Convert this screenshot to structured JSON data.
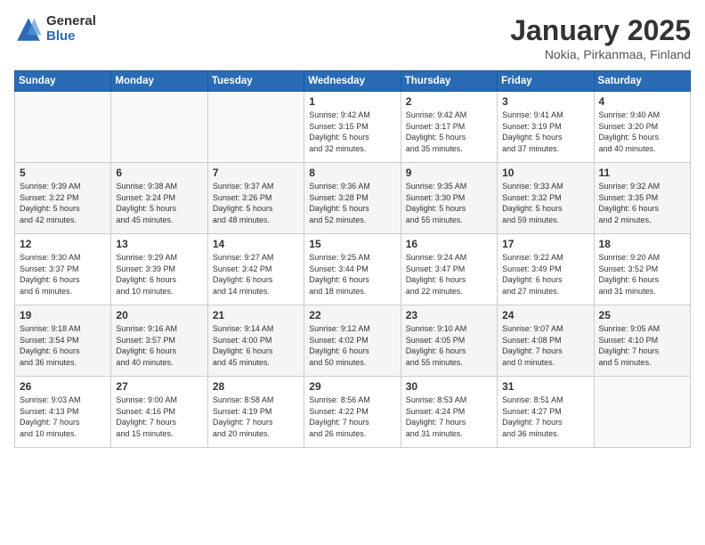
{
  "logo": {
    "general": "General",
    "blue": "Blue"
  },
  "title": "January 2025",
  "subtitle": "Nokia, Pirkanmaa, Finland",
  "weekdays": [
    "Sunday",
    "Monday",
    "Tuesday",
    "Wednesday",
    "Thursday",
    "Friday",
    "Saturday"
  ],
  "weeks": [
    [
      {
        "day": "",
        "info": ""
      },
      {
        "day": "",
        "info": ""
      },
      {
        "day": "",
        "info": ""
      },
      {
        "day": "1",
        "info": "Sunrise: 9:42 AM\nSunset: 3:15 PM\nDaylight: 5 hours\nand 32 minutes."
      },
      {
        "day": "2",
        "info": "Sunrise: 9:42 AM\nSunset: 3:17 PM\nDaylight: 5 hours\nand 35 minutes."
      },
      {
        "day": "3",
        "info": "Sunrise: 9:41 AM\nSunset: 3:19 PM\nDaylight: 5 hours\nand 37 minutes."
      },
      {
        "day": "4",
        "info": "Sunrise: 9:40 AM\nSunset: 3:20 PM\nDaylight: 5 hours\nand 40 minutes."
      }
    ],
    [
      {
        "day": "5",
        "info": "Sunrise: 9:39 AM\nSunset: 3:22 PM\nDaylight: 5 hours\nand 42 minutes."
      },
      {
        "day": "6",
        "info": "Sunrise: 9:38 AM\nSunset: 3:24 PM\nDaylight: 5 hours\nand 45 minutes."
      },
      {
        "day": "7",
        "info": "Sunrise: 9:37 AM\nSunset: 3:26 PM\nDaylight: 5 hours\nand 48 minutes."
      },
      {
        "day": "8",
        "info": "Sunrise: 9:36 AM\nSunset: 3:28 PM\nDaylight: 5 hours\nand 52 minutes."
      },
      {
        "day": "9",
        "info": "Sunrise: 9:35 AM\nSunset: 3:30 PM\nDaylight: 5 hours\nand 55 minutes."
      },
      {
        "day": "10",
        "info": "Sunrise: 9:33 AM\nSunset: 3:32 PM\nDaylight: 5 hours\nand 59 minutes."
      },
      {
        "day": "11",
        "info": "Sunrise: 9:32 AM\nSunset: 3:35 PM\nDaylight: 6 hours\nand 2 minutes."
      }
    ],
    [
      {
        "day": "12",
        "info": "Sunrise: 9:30 AM\nSunset: 3:37 PM\nDaylight: 6 hours\nand 6 minutes."
      },
      {
        "day": "13",
        "info": "Sunrise: 9:29 AM\nSunset: 3:39 PM\nDaylight: 6 hours\nand 10 minutes."
      },
      {
        "day": "14",
        "info": "Sunrise: 9:27 AM\nSunset: 3:42 PM\nDaylight: 6 hours\nand 14 minutes."
      },
      {
        "day": "15",
        "info": "Sunrise: 9:25 AM\nSunset: 3:44 PM\nDaylight: 6 hours\nand 18 minutes."
      },
      {
        "day": "16",
        "info": "Sunrise: 9:24 AM\nSunset: 3:47 PM\nDaylight: 6 hours\nand 22 minutes."
      },
      {
        "day": "17",
        "info": "Sunrise: 9:22 AM\nSunset: 3:49 PM\nDaylight: 6 hours\nand 27 minutes."
      },
      {
        "day": "18",
        "info": "Sunrise: 9:20 AM\nSunset: 3:52 PM\nDaylight: 6 hours\nand 31 minutes."
      }
    ],
    [
      {
        "day": "19",
        "info": "Sunrise: 9:18 AM\nSunset: 3:54 PM\nDaylight: 6 hours\nand 36 minutes."
      },
      {
        "day": "20",
        "info": "Sunrise: 9:16 AM\nSunset: 3:57 PM\nDaylight: 6 hours\nand 40 minutes."
      },
      {
        "day": "21",
        "info": "Sunrise: 9:14 AM\nSunset: 4:00 PM\nDaylight: 6 hours\nand 45 minutes."
      },
      {
        "day": "22",
        "info": "Sunrise: 9:12 AM\nSunset: 4:02 PM\nDaylight: 6 hours\nand 50 minutes."
      },
      {
        "day": "23",
        "info": "Sunrise: 9:10 AM\nSunset: 4:05 PM\nDaylight: 6 hours\nand 55 minutes."
      },
      {
        "day": "24",
        "info": "Sunrise: 9:07 AM\nSunset: 4:08 PM\nDaylight: 7 hours\nand 0 minutes."
      },
      {
        "day": "25",
        "info": "Sunrise: 9:05 AM\nSunset: 4:10 PM\nDaylight: 7 hours\nand 5 minutes."
      }
    ],
    [
      {
        "day": "26",
        "info": "Sunrise: 9:03 AM\nSunset: 4:13 PM\nDaylight: 7 hours\nand 10 minutes."
      },
      {
        "day": "27",
        "info": "Sunrise: 9:00 AM\nSunset: 4:16 PM\nDaylight: 7 hours\nand 15 minutes."
      },
      {
        "day": "28",
        "info": "Sunrise: 8:58 AM\nSunset: 4:19 PM\nDaylight: 7 hours\nand 20 minutes."
      },
      {
        "day": "29",
        "info": "Sunrise: 8:56 AM\nSunset: 4:22 PM\nDaylight: 7 hours\nand 26 minutes."
      },
      {
        "day": "30",
        "info": "Sunrise: 8:53 AM\nSunset: 4:24 PM\nDaylight: 7 hours\nand 31 minutes."
      },
      {
        "day": "31",
        "info": "Sunrise: 8:51 AM\nSunset: 4:27 PM\nDaylight: 7 hours\nand 36 minutes."
      },
      {
        "day": "",
        "info": ""
      }
    ]
  ]
}
